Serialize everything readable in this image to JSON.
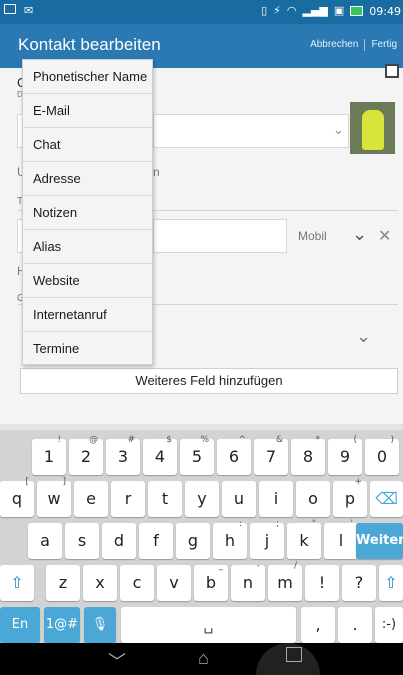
{
  "status_bar": {
    "time": "09:49",
    "icons": [
      "notification-icon",
      "mail-notification-icon",
      "vibrate-icon",
      "no-flash-icon",
      "wifi-icon",
      "signal-icon",
      "sim-icon",
      "battery-icon"
    ]
  },
  "app_bar": {
    "title": "Kontakt bearbeiten",
    "cancel_label": "Abbrechen",
    "done_label": "Fertig"
  },
  "form": {
    "partial_letters": [
      "G",
      "D",
      "U",
      "T",
      "H",
      "G"
    ],
    "partial_suffix": "n",
    "phone_type": "Mobil",
    "add_field_label": "Weiteres Feld hinzufügen"
  },
  "menu": {
    "items": [
      "Phonetischer Name",
      "E-Mail",
      "Chat",
      "Adresse",
      "Notizen",
      "Alias",
      "Website",
      "Internetanruf",
      "Termine"
    ]
  },
  "keyboard": {
    "row1": [
      {
        "k": "1",
        "s": "!"
      },
      {
        "k": "2",
        "s": "@"
      },
      {
        "k": "3",
        "s": "#"
      },
      {
        "k": "4",
        "s": "$"
      },
      {
        "k": "5",
        "s": "%"
      },
      {
        "k": "6",
        "s": "^"
      },
      {
        "k": "7",
        "s": "&"
      },
      {
        "k": "8",
        "s": "*"
      },
      {
        "k": "9",
        "s": "("
      },
      {
        "k": "0",
        "s": ")"
      }
    ],
    "row2": [
      {
        "k": "q",
        "s": "["
      },
      {
        "k": "w",
        "s": "]"
      },
      {
        "k": "e",
        "s": ""
      },
      {
        "k": "r",
        "s": ""
      },
      {
        "k": "t",
        "s": ""
      },
      {
        "k": "y",
        "s": ""
      },
      {
        "k": "u",
        "s": ""
      },
      {
        "k": "i",
        "s": ""
      },
      {
        "k": "o",
        "s": ""
      },
      {
        "k": "p",
        "s": "+"
      }
    ],
    "row3": [
      {
        "k": "a",
        "s": ""
      },
      {
        "k": "s",
        "s": ""
      },
      {
        "k": "d",
        "s": ""
      },
      {
        "k": "f",
        "s": ""
      },
      {
        "k": "g",
        "s": ""
      },
      {
        "k": "h",
        "s": ":"
      },
      {
        "k": "j",
        "s": ";"
      },
      {
        "k": "k",
        "s": "\""
      },
      {
        "k": "l",
        "s": "'"
      }
    ],
    "row4": [
      {
        "k": "z",
        "s": ""
      },
      {
        "k": "x",
        "s": ""
      },
      {
        "k": "c",
        "s": ""
      },
      {
        "k": "v",
        "s": ""
      },
      {
        "k": "b",
        "s": "_"
      },
      {
        "k": "n",
        "s": "-"
      },
      {
        "k": "m",
        "s": "/"
      },
      {
        "k": "!",
        "s": ""
      },
      {
        "k": "?",
        "s": ""
      }
    ],
    "backspace_symbol": "⌫",
    "enter_label": "Weiter",
    "shift_symbol": "⇧",
    "lang_label": "En",
    "symbols_label": "1@#",
    "mic_symbol": "🎙",
    "space_symbol": "␣",
    "comma": ",",
    "period": ".",
    "smiley": ":-)"
  },
  "nav_bar": {
    "back_symbol": "﹀",
    "home_symbol": "⌂"
  }
}
